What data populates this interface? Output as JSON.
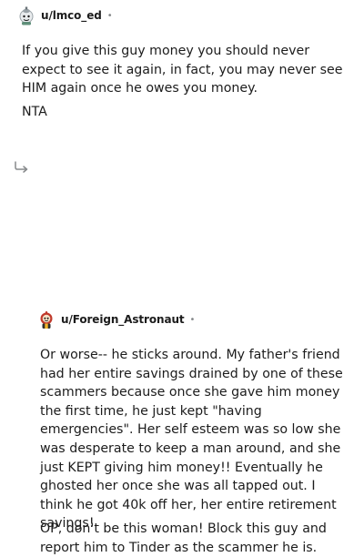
{
  "comments": [
    {
      "username": "u/lmco_ed",
      "separator": "•",
      "avatar_icon": "snoo-avatar-icon",
      "paragraphs": [
        "If you give this guy money you should never expect to see it again, in fact, you may never see HIM again once he owes you money.",
        "NTA"
      ]
    },
    {
      "username": "u/Foreign_Astronaut",
      "separator": "•",
      "avatar_icon": "snoo-avatar-icon",
      "reply_icon": "reply-arrow-icon",
      "paragraphs": [
        "Or worse-- he sticks around. My father's friend had her entire savings drained by one of these scammers because once she gave him money the first time, he just kept \"having emergencies\". Her self esteem was so low she was desperate to keep a man around, and she just KEPT giving him money!! Eventually he ghosted her once she was all tapped out. I think he got 40k off her, her entire retirement savings!",
        "OP, don't be this woman! Block this guy and report him to Tinder as the scammer he is."
      ]
    }
  ],
  "colors": {
    "text": "#1c1c1c",
    "muted": "#878a8c",
    "avatar1_accent": "#9aa3a8",
    "avatar2_accent": "#c0392b"
  }
}
